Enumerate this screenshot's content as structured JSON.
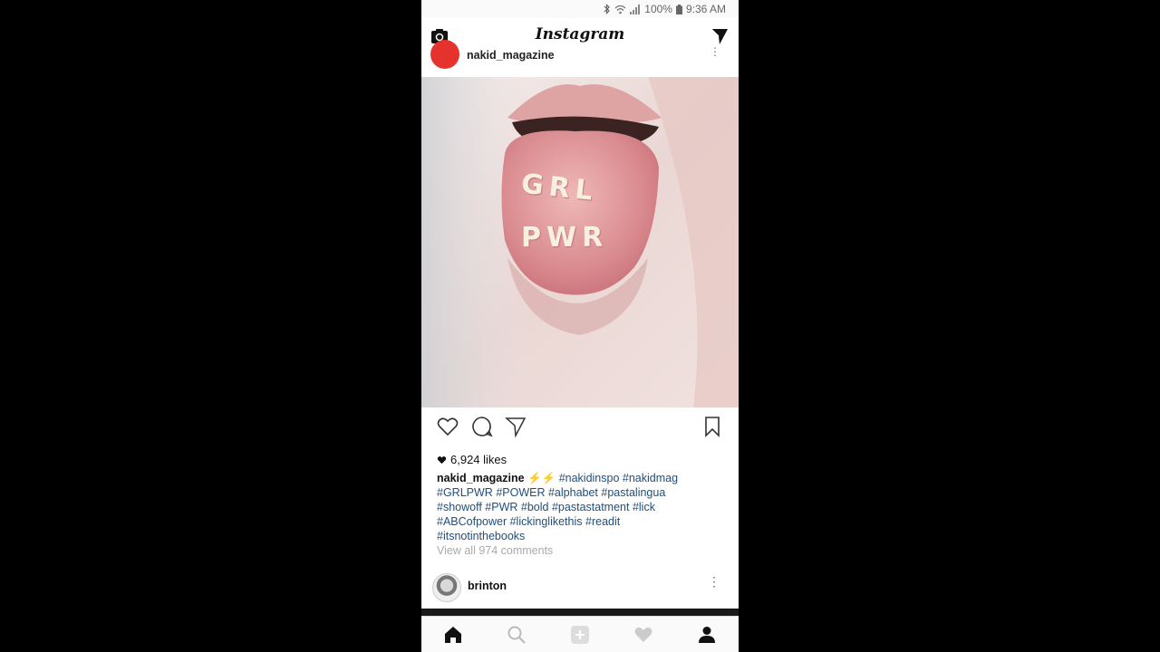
{
  "status_bar": {
    "battery": "100%",
    "time": "9:36 AM"
  },
  "header": {
    "title": "Instagram",
    "camera_icon": "camera-icon",
    "direct_icon": "paper-plane-icon"
  },
  "post": {
    "username": "nakid_magazine",
    "image_text_line1": "GRL",
    "image_text_line2": "PWR",
    "likes": "6,924 likes",
    "caption_username": "nakid_magazine",
    "caption_emoji": "⚡⚡",
    "hashtags": [
      "#nakidinspo",
      "#nakidmag",
      "#GRLPWR",
      "#POWER",
      "#alphabet",
      "#pastalingua",
      "#showoff",
      "#PWR",
      "#bold",
      "#pastastatment",
      "#lick",
      "#ABCofpower",
      "#lickinglikethis",
      "#readit",
      "#itsnotinthebooks"
    ],
    "view_comments": "View all 974 comments"
  },
  "next_post": {
    "username": "brinton"
  },
  "bottom_nav": [
    "home-icon",
    "search-icon",
    "add-icon",
    "heart-icon",
    "profile-icon"
  ]
}
